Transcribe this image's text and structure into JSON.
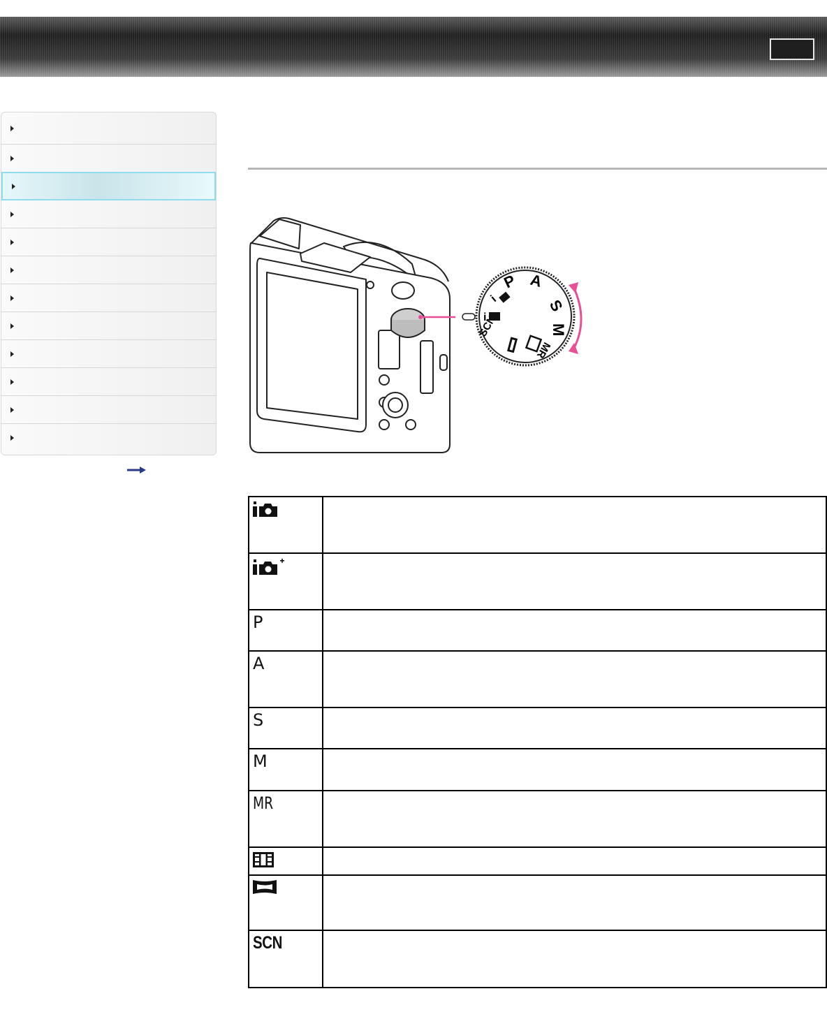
{
  "header": {
    "button_label": ""
  },
  "sidebar": {
    "items": [
      {
        "label": "",
        "active": false
      },
      {
        "label": "",
        "active": false
      },
      {
        "label": "",
        "active": true
      },
      {
        "label": "",
        "active": false
      },
      {
        "label": "",
        "active": false
      },
      {
        "label": "",
        "active": false
      },
      {
        "label": "",
        "active": false
      },
      {
        "label": "",
        "active": false
      },
      {
        "label": "",
        "active": false
      },
      {
        "label": "",
        "active": false
      },
      {
        "label": "",
        "active": false
      },
      {
        "label": "",
        "active": false
      }
    ],
    "more_link_icon": "right-arrow-icon"
  },
  "figure": {
    "dial_labels": [
      "P",
      "A",
      "S",
      "M",
      "MR",
      "SCN"
    ],
    "accent_color": "#e94e97"
  },
  "modes": [
    {
      "icon": "intelligent-auto-icon",
      "label": "",
      "description": ""
    },
    {
      "icon": "superior-auto-icon",
      "label": "",
      "description": ""
    },
    {
      "icon": "text",
      "label": "P",
      "description": ""
    },
    {
      "icon": "text",
      "label": "A",
      "description": ""
    },
    {
      "icon": "text",
      "label": "S",
      "description": ""
    },
    {
      "icon": "text",
      "label": "M",
      "description": ""
    },
    {
      "icon": "text",
      "label": "MR",
      "description": ""
    },
    {
      "icon": "movie-icon",
      "label": "",
      "description": ""
    },
    {
      "icon": "sweep-panorama-icon",
      "label": "",
      "description": ""
    },
    {
      "icon": "text",
      "label": "SCN",
      "description": ""
    }
  ]
}
